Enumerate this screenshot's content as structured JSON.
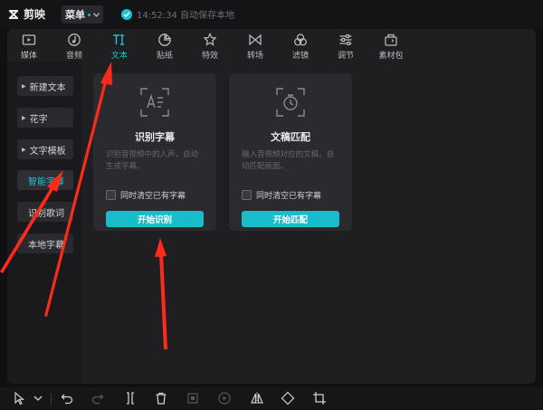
{
  "app": {
    "name": "剪映"
  },
  "titlebar": {
    "menu_label": "菜单",
    "save_status": "14:52:34 自动保存本地"
  },
  "tabs": [
    {
      "label": "媒体",
      "icon": "media-icon"
    },
    {
      "label": "音频",
      "icon": "audio-icon"
    },
    {
      "label": "文本",
      "icon": "text-icon",
      "active": true
    },
    {
      "label": "贴纸",
      "icon": "sticker-icon"
    },
    {
      "label": "特效",
      "icon": "effects-icon"
    },
    {
      "label": "转场",
      "icon": "transition-icon"
    },
    {
      "label": "滤镜",
      "icon": "filter-icon"
    },
    {
      "label": "调节",
      "icon": "adjust-icon"
    },
    {
      "label": "素材包",
      "icon": "material-pack-icon"
    }
  ],
  "sidebar": {
    "items": [
      {
        "label": "新建文本"
      },
      {
        "label": "花字"
      },
      {
        "label": "文字模板"
      },
      {
        "label": "智能字幕"
      },
      {
        "label": "识别歌词"
      },
      {
        "label": "本地字幕"
      }
    ]
  },
  "cards": [
    {
      "title": "识别字幕",
      "desc": "识别音视频中的人声，自动生成字幕。",
      "option": "同时清空已有字幕",
      "button": "开始识别"
    },
    {
      "title": "文稿匹配",
      "desc": "输入音视频对应的文稿，自动匹配画面。",
      "option": "同时清空已有字幕",
      "button": "开始匹配"
    }
  ],
  "colors": {
    "accent": "#1ec4d4",
    "annotation": "#ff2a1a"
  }
}
